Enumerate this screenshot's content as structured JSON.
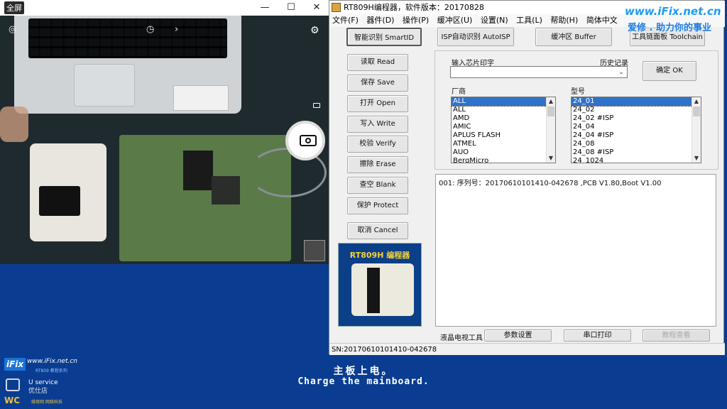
{
  "camera": {
    "fullscreen_label": "全屏",
    "window_controls": [
      "—",
      "☐",
      "✕"
    ]
  },
  "app": {
    "title": "RT809H编程器，软件版本：20170828",
    "menu": [
      "文件(F)",
      "器件(D)",
      "操作(P)",
      "缓冲区(U)",
      "设置(N)",
      "工具(L)",
      "帮助(H)",
      "简体中文"
    ],
    "top_buttons": {
      "smartid": "智能识别 SmartID",
      "autoisp": "ISP自动识别 AutoISP",
      "buffer": "缓冲区 Buffer",
      "toolchain": "工具链面板 Toolchain"
    },
    "side_buttons": {
      "read": "读取 Read",
      "save": "保存 Save",
      "open": "打开 Open",
      "write": "写入 Write",
      "verify": "校验 Verify",
      "erase": "擦除 Erase",
      "blank": "查空 Blank",
      "protect": "保护 Protect",
      "cancel": "取消 Cancel"
    },
    "chip_input_label": "输入芯片印字",
    "history_label": "历史记录",
    "chip_input_value": "",
    "ok_button": "确定 OK",
    "vendor_label": "厂商",
    "model_label": "型号",
    "vendors": [
      "ALL",
      "ALL",
      "AMD",
      "AMIC",
      "APLUS FLASH",
      "ATMEL",
      "AUO",
      "BergMicro"
    ],
    "models": [
      "24_01",
      "24_02",
      "24_02 #ISP",
      "24_04",
      "24_04 #ISP",
      "24_08",
      "24_08 #ISP",
      "24_1024"
    ],
    "log_text": "001: 序列号：20170610101410-042678 ,PCB V1.80,Boot V1.00",
    "product_title": "RT809H 编程器",
    "bottom": {
      "lcd_tools": "液晶电视工具",
      "params": "参数设置",
      "serial_print": "串口打印",
      "tutorial": "教程查看"
    },
    "status_sn": "SN:20170610101410-042678"
  },
  "watermark": {
    "url": "www.iFix.net.cn",
    "slogan": "爱修 . 助力你的事业"
  },
  "caption": {
    "cn": "主板上电。",
    "en": "Charge the mainboard."
  },
  "logos": {
    "ifix": "iFix",
    "ifix_url": "www.iFix.net.cn",
    "ifix_sub": "RT809 教程系列",
    "service": "U service",
    "service_cn": "优仕店",
    "wc": "WC",
    "wc_sub": "维修网 网络科技"
  }
}
